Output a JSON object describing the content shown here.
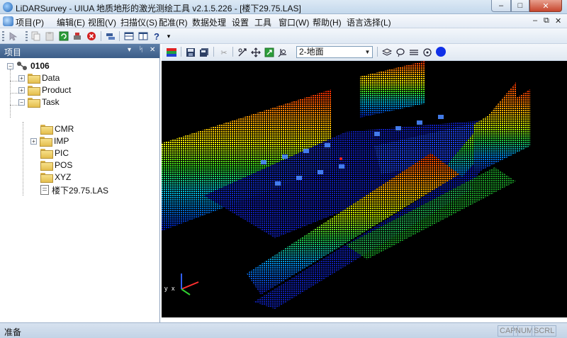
{
  "window": {
    "title": "LiDARSurvey - UIUA 地质地形的激光测绘工具 v2.1.5.226 - [楼下29.75.LAS]",
    "minimize": "–",
    "maximize": "□",
    "close": "✕"
  },
  "menu": {
    "items": [
      "项目(P)",
      "编辑(E)",
      "视图(V)",
      "扫描仪(S)",
      "配准(R)",
      "数据处理",
      "设置",
      "工具",
      "窗口(W)",
      "帮助(H)",
      "语言选择(L)"
    ],
    "mdi_min": "–",
    "mdi_restore": "⧉",
    "mdi_close": "✕"
  },
  "project_panel": {
    "title": "项目",
    "buttons": [
      "▾",
      "ᛋ",
      "✕"
    ],
    "tree": {
      "root": "0106",
      "children": [
        "Data",
        "Product",
        "Task"
      ],
      "task_children": [
        "CMR",
        "IMP",
        "PIC",
        "POS",
        "XYZ",
        "楼下29.75.LAS"
      ]
    }
  },
  "view_toolbar": {
    "combo_value": "2-地面"
  },
  "axis": {
    "x": "x",
    "y": "y",
    "z": "z"
  },
  "status": {
    "text": "准备",
    "indicators": [
      "CAP",
      "NUM",
      "SCRL"
    ]
  },
  "colors": {
    "panel_header": "#3c5d88",
    "canvas_bg": "#000000",
    "close": "#c6452d"
  }
}
